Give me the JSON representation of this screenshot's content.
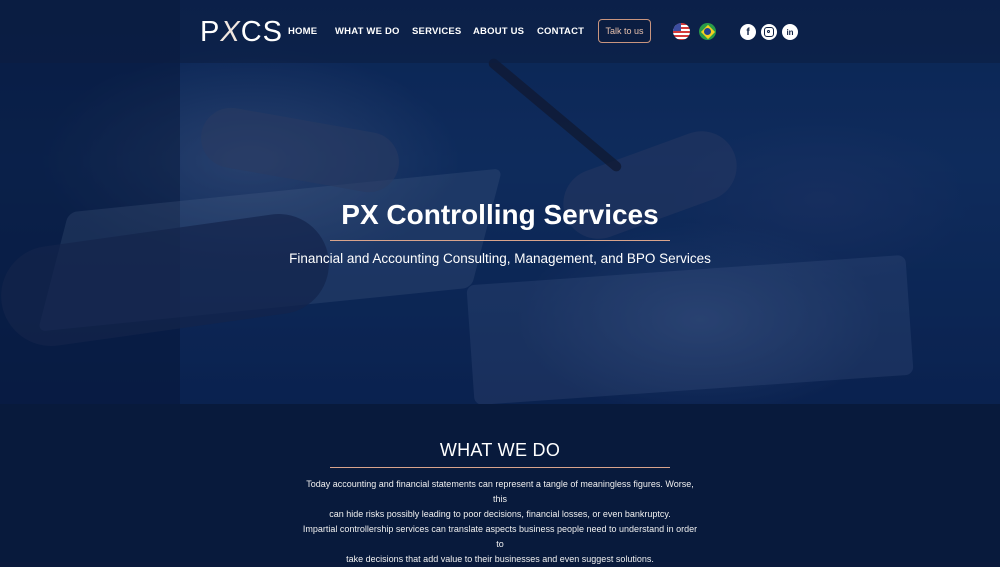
{
  "brand": {
    "logo_pre": "P",
    "logo_x": "X",
    "logo_post": "CS"
  },
  "nav": {
    "items": [
      {
        "label": "HOME"
      },
      {
        "label": "WHAT WE DO"
      },
      {
        "label": "SERVICES"
      },
      {
        "label": "ABOUT US"
      },
      {
        "label": "CONTACT"
      }
    ],
    "cta_label": "Talk to us",
    "languages": [
      {
        "icon": "flag-us-icon"
      },
      {
        "icon": "flag-br-icon"
      }
    ],
    "social": [
      {
        "icon": "facebook-icon",
        "glyph": "f"
      },
      {
        "icon": "instagram-icon"
      },
      {
        "icon": "linkedin-icon",
        "glyph": "in"
      }
    ]
  },
  "hero": {
    "title": "PX Controlling Services",
    "subtitle": "Financial and Accounting Consulting, Management, and BPO Services"
  },
  "what_we_do": {
    "title": "WHAT WE DO",
    "paragraph1_line1": "Today accounting and financial statements can represent a tangle of meaningless figures. Worse, this",
    "paragraph1_line2": "can hide risks possibly leading to poor decisions, financial losses, or even bankruptcy.",
    "paragraph2_line1": "Impartial controllership services can translate aspects business people need to understand in order to",
    "paragraph2_line2": "take decisions that add value to their businesses and even suggest solutions."
  },
  "colors": {
    "accent": "#d9a48c",
    "background": "#081a3c",
    "header": "#0c1e40"
  }
}
